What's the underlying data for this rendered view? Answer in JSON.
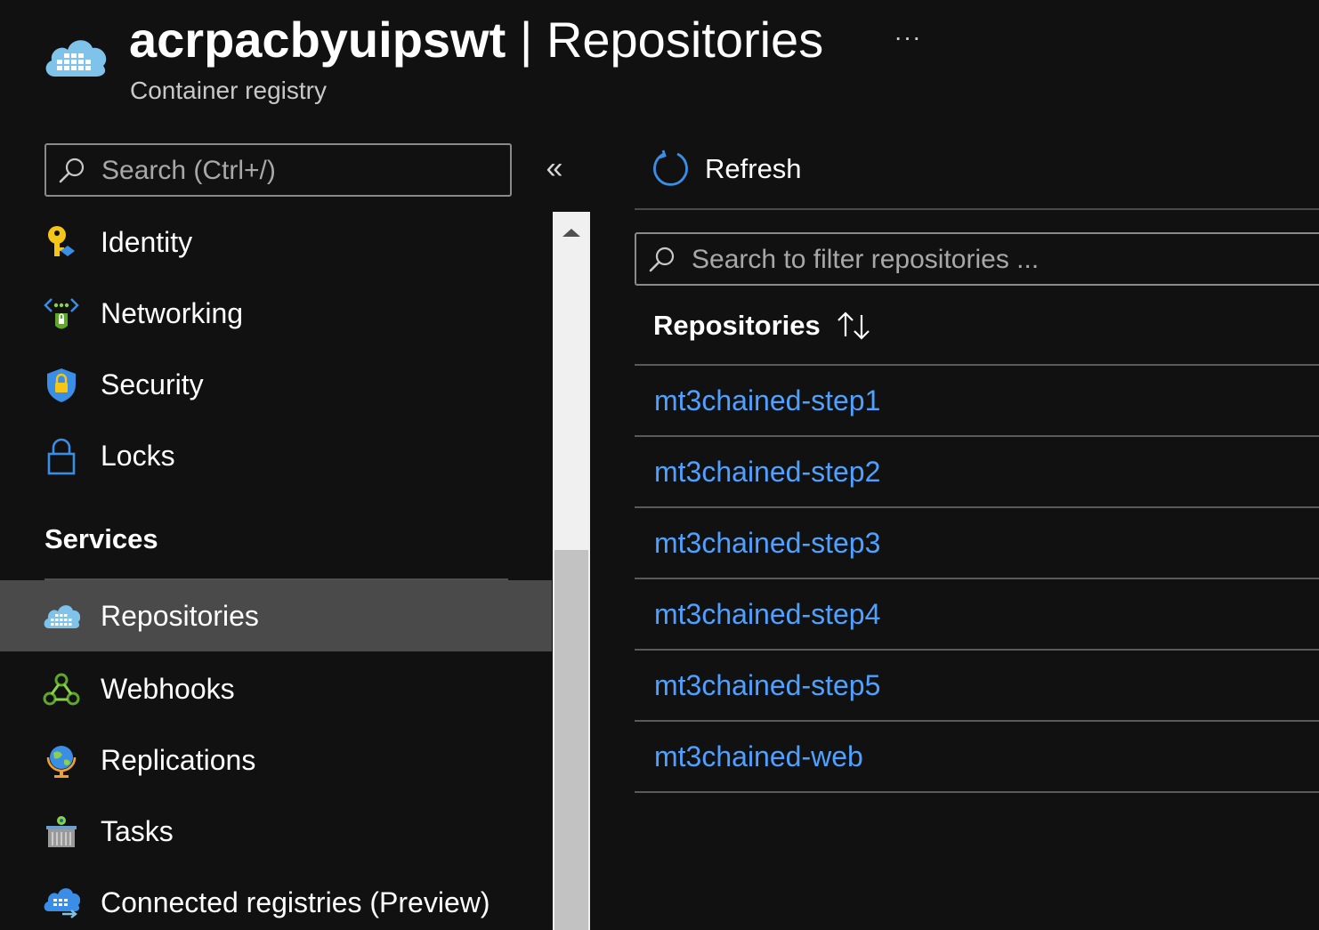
{
  "header": {
    "resource_name": "acrpacbyuipswt",
    "separator": " | ",
    "page_name": "Repositories",
    "subtitle": "Container registry",
    "more_label": "···",
    "icon": "container-registry-icon"
  },
  "sidebar": {
    "search_placeholder": "Search (Ctrl+/)",
    "collapse_label": "«",
    "items_top": [
      {
        "label": "Identity",
        "icon": "identity-key-icon"
      },
      {
        "label": "Networking",
        "icon": "networking-icon"
      },
      {
        "label": "Security",
        "icon": "security-shield-icon"
      },
      {
        "label": "Locks",
        "icon": "lock-icon"
      }
    ],
    "services_header": "Services",
    "items_services": [
      {
        "label": "Repositories",
        "icon": "repositories-icon",
        "selected": true
      },
      {
        "label": "Webhooks",
        "icon": "webhooks-icon"
      },
      {
        "label": "Replications",
        "icon": "replications-globe-icon"
      },
      {
        "label": "Tasks",
        "icon": "tasks-icon"
      },
      {
        "label": "Connected registries (Preview)",
        "icon": "connected-registries-icon"
      }
    ]
  },
  "main": {
    "refresh_label": "Refresh",
    "filter_placeholder": "Search to filter repositories ...",
    "column_header": "Repositories",
    "repositories": [
      "mt3chained-step1",
      "mt3chained-step2",
      "mt3chained-step3",
      "mt3chained-step4",
      "mt3chained-step5",
      "mt3chained-web"
    ]
  },
  "colors": {
    "background": "#111111",
    "link": "#4ea1ff",
    "selected_item": "#4a4a4a",
    "accent_blue": "#3a8ee6"
  }
}
